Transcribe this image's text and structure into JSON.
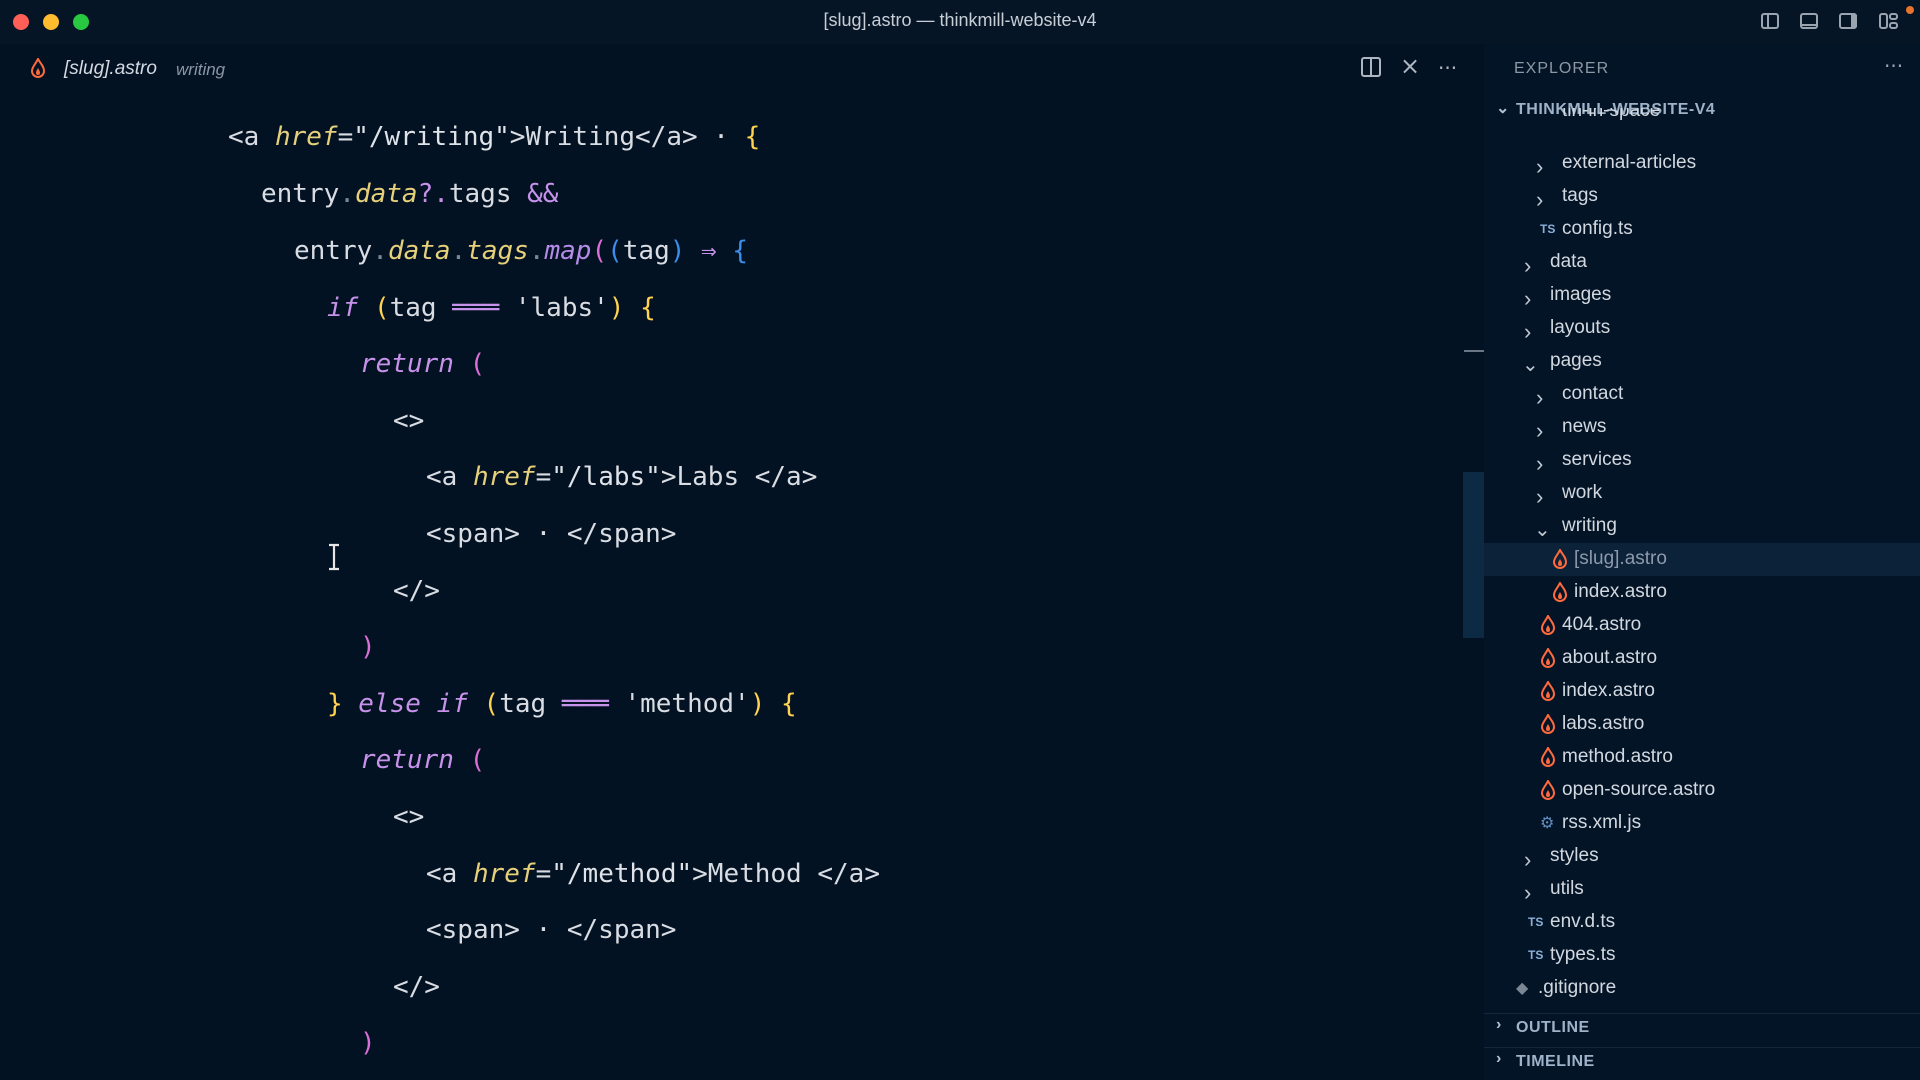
{
  "window": {
    "title": "[slug].astro — thinkmill-website-v4"
  },
  "editor_tab": {
    "filename": "[slug].astro",
    "folder": "writing",
    "split_icon": "split-editor-icon",
    "close_symbol": "×",
    "more_symbol": "···"
  },
  "code": {
    "l1_open": "<a ",
    "l1_attr": "href",
    "l1_eq": "=",
    "l1_str": "\"/writing\"",
    "l1_text": ">Writing</a> · ",
    "l1_brace": "{",
    "l2_obj": "entry",
    "l2_dot": ".",
    "l2_prop": "data",
    "l2_opt": "?.",
    "l2_tags": "tags ",
    "l2_and": "&&",
    "l3_obj": "entry",
    "l3_dot1": ".",
    "l3_prop1": "data",
    "l3_dot2": ".",
    "l3_prop2": "tags",
    "l3_dot3": ".",
    "l3_fn": "map",
    "l3_p1": "(",
    "l3_p2": "(",
    "l3_arg": "tag",
    "l3_p3": ")",
    "l3_arrow": " ⇒ ",
    "l3_brace": "{",
    "l4_if": "if",
    "l4_p": " (",
    "l4_var": "tag ",
    "l4_eq": "═══",
    "l4_str": " 'labs'",
    "l4_pc": ")",
    "l4_brace": " {",
    "l5_ret": "return",
    "l5_p": " (",
    "l6_frag": "<>",
    "l7_open": "<a ",
    "l7_attr": "href",
    "l7_eq": "=",
    "l7_str": "\"/labs\"",
    "l7_text": ">Labs </a>",
    "l8_span": "<span> · </span>",
    "l9_close": "</>",
    "l10_paren": ")",
    "l11_brace": "}",
    "l11_else": " else if",
    "l11_p": " (",
    "l11_var": "tag ",
    "l11_eq": "═══",
    "l11_str": " 'method'",
    "l11_pc": ")",
    "l11_b": " {",
    "l12_ret": "return",
    "l12_p": " (",
    "l13_frag": "<>",
    "l14_open": "<a ",
    "l14_attr": "href",
    "l14_eq": "=",
    "l14_str": "\"/method\"",
    "l14_text": ">Method </a>",
    "l15_span": "<span> · </span>",
    "l16_close": "</>",
    "l17_paren": ")"
  },
  "explorer": {
    "title": "EXPLORER",
    "more": "···",
    "root": "THINKMILL-WEBSITE-V4",
    "items": [
      {
        "label": "tin-in-space",
        "icon": "chevron-right-icon"
      },
      {
        "label": "external-articles",
        "icon": "chevron-right-icon"
      },
      {
        "label": "tags",
        "icon": "chevron-right-icon"
      },
      {
        "label": "config.ts",
        "icon": "typescript-file-icon",
        "badge": "TS"
      },
      {
        "label": "data",
        "icon": "chevron-right-icon"
      },
      {
        "label": "images",
        "icon": "chevron-right-icon"
      },
      {
        "label": "layouts",
        "icon": "chevron-right-icon"
      },
      {
        "label": "pages",
        "icon": "chevron-down-icon"
      },
      {
        "label": "contact",
        "icon": "chevron-right-icon"
      },
      {
        "label": "news",
        "icon": "chevron-right-icon"
      },
      {
        "label": "services",
        "icon": "chevron-right-icon"
      },
      {
        "label": "work",
        "icon": "chevron-right-icon"
      },
      {
        "label": "writing",
        "icon": "chevron-down-icon"
      },
      {
        "label": "[slug].astro",
        "icon": "astro-file-icon"
      },
      {
        "label": "index.astro",
        "icon": "astro-file-icon"
      },
      {
        "label": "404.astro",
        "icon": "astro-file-icon"
      },
      {
        "label": "about.astro",
        "icon": "astro-file-icon"
      },
      {
        "label": "index.astro",
        "icon": "astro-file-icon"
      },
      {
        "label": "labs.astro",
        "icon": "astro-file-icon"
      },
      {
        "label": "method.astro",
        "icon": "astro-file-icon"
      },
      {
        "label": "open-source.astro",
        "icon": "astro-file-icon"
      },
      {
        "label": "rss.xml.js",
        "icon": "gear-file-icon"
      },
      {
        "label": "styles",
        "icon": "chevron-right-icon"
      },
      {
        "label": "utils",
        "icon": "chevron-right-icon"
      },
      {
        "label": "env.d.ts",
        "icon": "typescript-file-icon",
        "badge": "TS"
      },
      {
        "label": "types.ts",
        "icon": "typescript-file-icon",
        "badge": "TS"
      },
      {
        "label": ".gitignore",
        "icon": "git-file-icon"
      }
    ],
    "outline": "OUTLINE",
    "timeline": "TIMELINE"
  },
  "colors": {
    "background": "#031223",
    "sidebar": "#041427",
    "keyword": "#c792ea",
    "attribute": "#e6d07a",
    "bracket_gold": "#ffd34e",
    "bracket_magenta": "#da70d6",
    "bracket_blue": "#3b8eea",
    "astro_icon": "#ff6a3d"
  }
}
